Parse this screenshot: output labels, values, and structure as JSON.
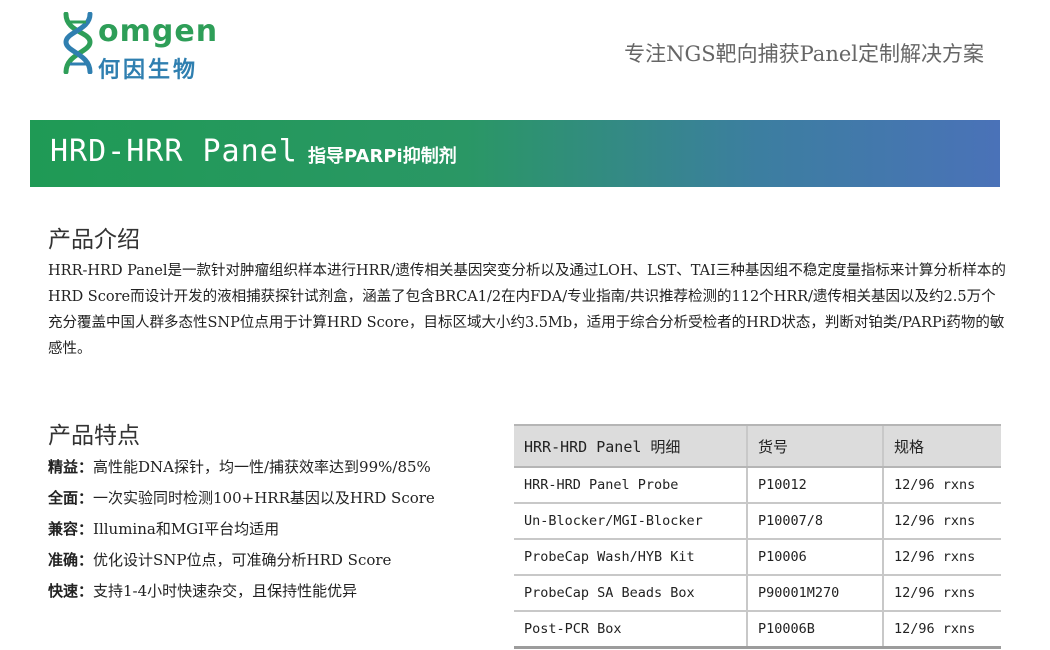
{
  "logo": {
    "name_en": "omgen",
    "name_cn": "何因生物",
    "mark_icon": "dna-helix-h-icon",
    "colors": {
      "green": "#2e9e58",
      "blue": "#2f7fb0"
    }
  },
  "header": {
    "tagline": "专注NGS靶向捕获Panel定制解决方案"
  },
  "banner": {
    "title": "HRD-HRR Panel",
    "subtitle": "指导PARPi抑制剂",
    "colors": {
      "start": "#1f9a55",
      "end": "#4a72b8"
    }
  },
  "intro": {
    "heading": "产品介绍",
    "text": "HRR-HRD Panel是一款针对肿瘤组织样本进行HRR/遗传相关基因突变分析以及通过LOH、LST、TAI三种基因组不稳定度量指标来计算分析样本的HRD Score而设计开发的液相捕获探针试剂盒，涵盖了包含BRCA1/2在内FDA/专业指南/共识推荐检测的112个HRR/遗传相关基因以及约2.5万个充分覆盖中国人群多态性SNP位点用于计算HRD Score，目标区域大小约3.5Mb，适用于综合分析受检者的HRD状态，判断对铂类/PARPi药物的敏感性。"
  },
  "features": {
    "heading": "产品特点",
    "items": [
      {
        "key": "精益：",
        "text": "高性能DNA探针，均一性/捕获效率达到99%/85%"
      },
      {
        "key": "全面：",
        "text": "一次实验同时检测100+HRR基因以及HRD Score"
      },
      {
        "key": "兼容：",
        "text": "Illumina和MGI平台均适用"
      },
      {
        "key": "准确：",
        "text": "优化设计SNP位点，可准确分析HRD Score"
      },
      {
        "key": "快速：",
        "text": "支持1-4小时快速杂交，且保持性能优异"
      }
    ]
  },
  "table": {
    "headers": [
      "HRR-HRD Panel 明细",
      "货号",
      "规格"
    ],
    "rows": [
      [
        "HRR-HRD Panel Probe",
        "P10012",
        "12/96 rxns"
      ],
      [
        "Un-Blocker/MGI-Blocker",
        "P10007/8",
        "12/96 rxns"
      ],
      [
        "ProbeCap Wash/HYB Kit",
        "P10006",
        "12/96 rxns"
      ],
      [
        "ProbeCap SA Beads Box",
        "P90001M270",
        "12/96 rxns"
      ],
      [
        "Post-PCR Box",
        "P10006B",
        "12/96 rxns"
      ]
    ]
  }
}
